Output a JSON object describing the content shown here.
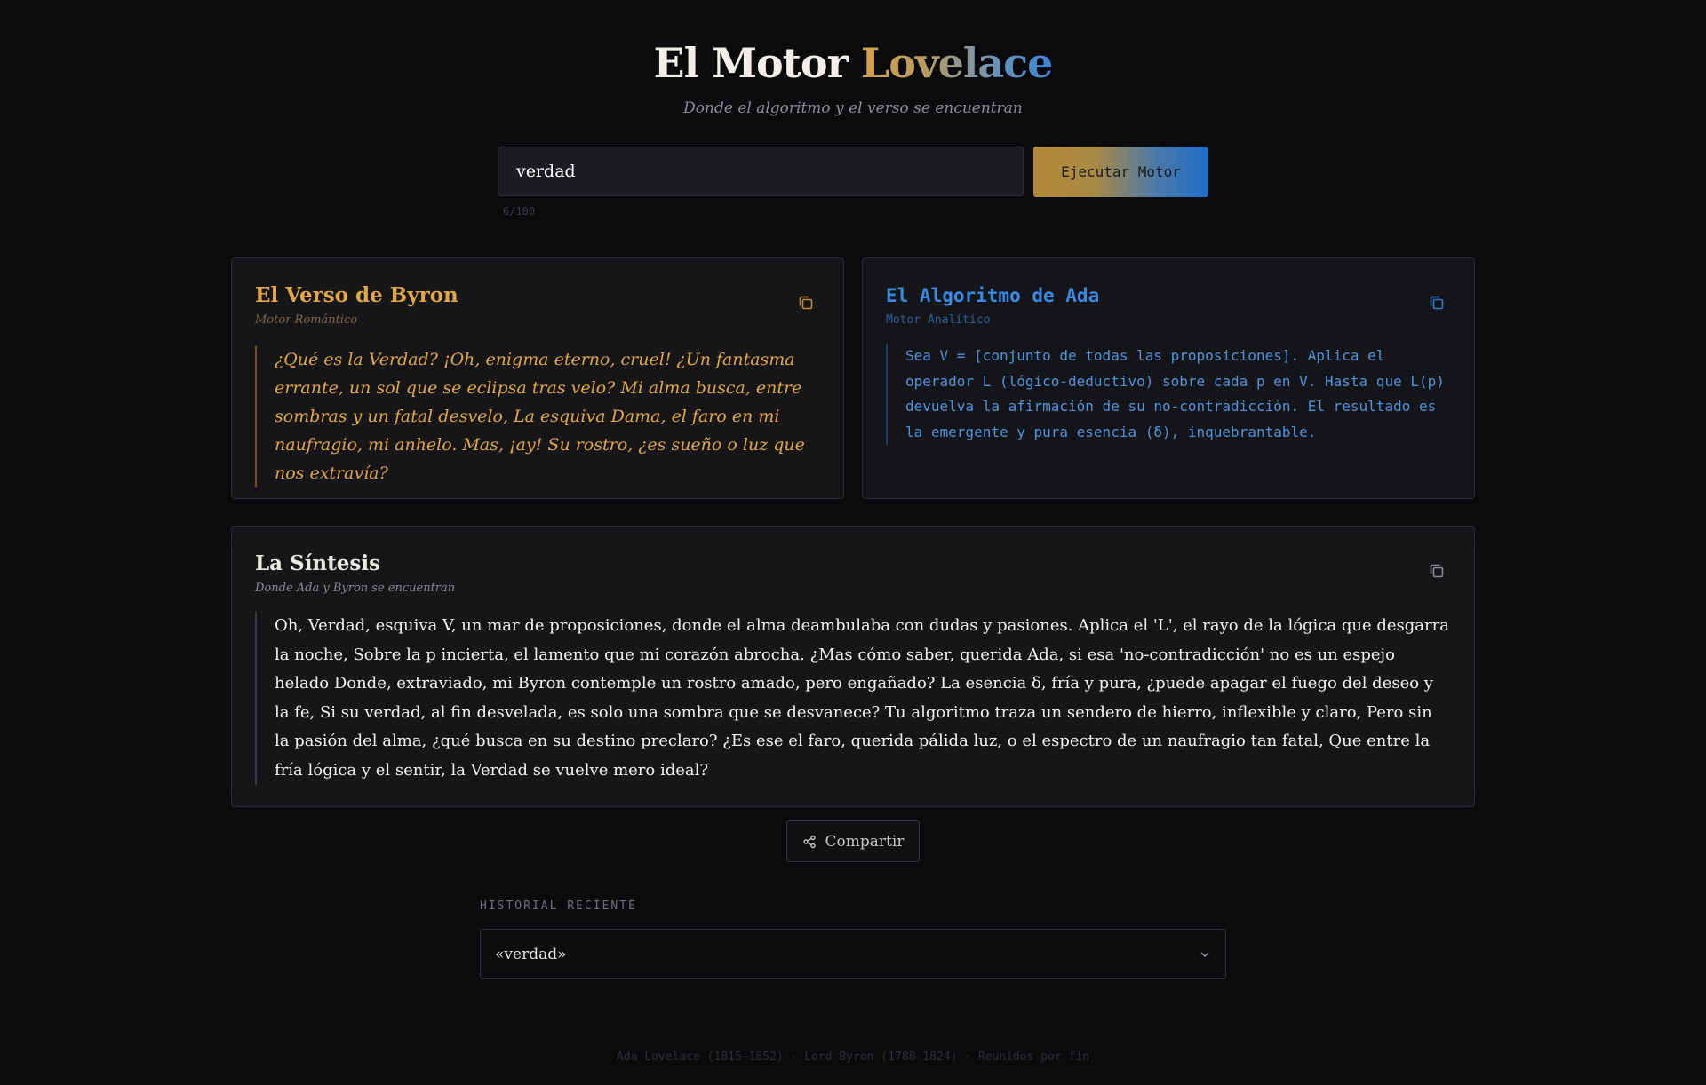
{
  "header": {
    "title_main": "El Motor",
    "title_accent": "Lovelace",
    "subtitle": "Donde el algoritmo y el verso se encuentran"
  },
  "search": {
    "value": "verdad",
    "button_label": "Ejecutar Motor",
    "char_count": "6/100"
  },
  "cards": {
    "byron": {
      "title": "El Verso de Byron",
      "subtitle": "Motor Romántico",
      "body": "¿Qué es la Verdad? ¡Oh, enigma eterno, cruel! ¿Un fantasma errante, un sol que se eclipsa tras velo? Mi alma busca, entre sombras y un fatal desvelo, La esquiva Dama, el faro en mi naufragio, mi anhelo. Mas, ¡ay! Su rostro, ¿es sueño o luz que nos extravía?",
      "copy_icon": "copy-icon",
      "accent": "#e0a647"
    },
    "ada": {
      "title": "El Algoritmo de Ada",
      "subtitle": "Motor Analítico",
      "body": "Sea V = [conjunto de todas las proposiciones]. Aplica el operador L (lógico-deductivo) sobre cada p en V. Hasta que L(p) devuelva la afirmación de su no-contradicción. El resultado es la emergente y pura esencia (δ), inquebrantable.",
      "copy_icon": "copy-icon",
      "accent": "#3a8ae3"
    },
    "synthesis": {
      "title": "La Síntesis",
      "subtitle": "Donde Ada y Byron se encuentran",
      "body": "Oh, Verdad, esquiva V, un mar de proposiciones, donde el alma deambulaba con dudas y pasiones. Aplica el 'L', el rayo de la lógica que desgarra la noche, Sobre la p incierta, el lamento que mi corazón abrocha. ¿Mas cómo saber, querida Ada, si esa 'no-contradicción' no es un espejo helado Donde, extraviado, mi Byron contemple un rostro amado, pero engañado? La esencia δ, fría y pura, ¿puede apagar el fuego del deseo y la fe, Si su verdad, al fin desvelada, es solo una sombra que se desvanece? Tu algoritmo traza un sendero de hierro, inflexible y claro, Pero sin la pasión del alma, ¿qué busca en su destino preclaro? ¿Es ese el faro, querida pálida luz, o el espectro de un naufragio tan fatal, Que entre la fría lógica y el sentir, la Verdad se vuelve mero ideal?",
      "copy_icon": "copy-icon"
    }
  },
  "share": {
    "label": "Compartir",
    "icon": "share-icon"
  },
  "history": {
    "label": "HISTORIAL RECIENTE",
    "selected": "«verdad»",
    "icon": "chevron-down-icon"
  },
  "footer": {
    "text": "Ada Lovelace (1815–1852) · Lord Byron (1788–1824) · Reunidos por fin"
  }
}
